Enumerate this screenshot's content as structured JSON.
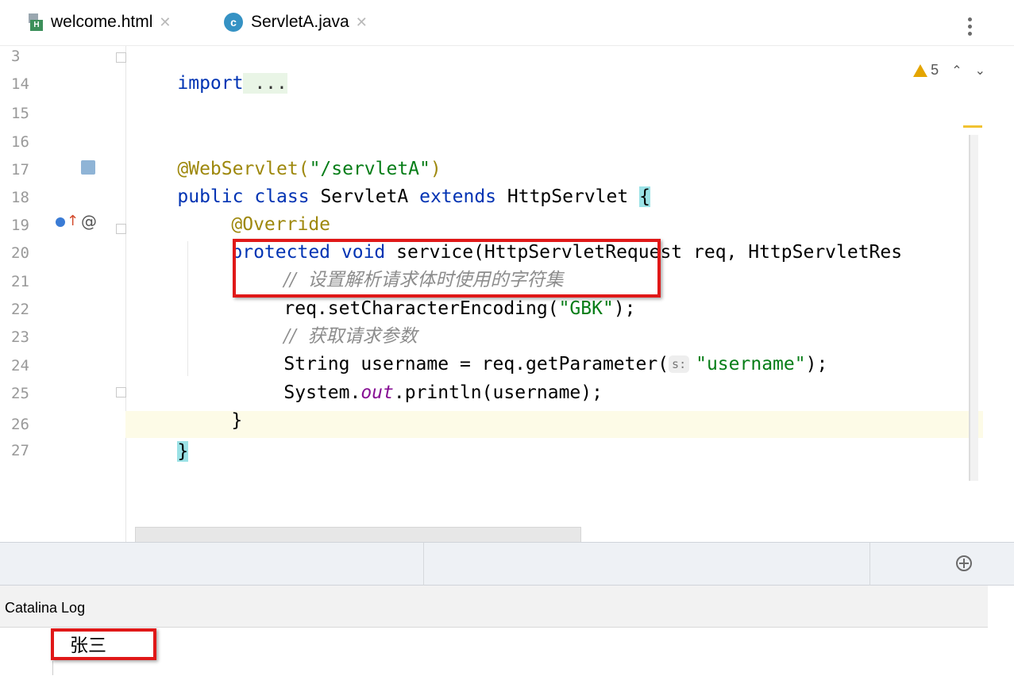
{
  "tabs": [
    {
      "label": "welcome.html",
      "icon": "html-file-icon",
      "active": false
    },
    {
      "label": "ServletA.java",
      "icon": "class-file-icon",
      "active": true
    }
  ],
  "inspection": {
    "warnings": "5"
  },
  "gutter": {
    "line_numbers": [
      "3",
      "14",
      "15",
      "16",
      "17",
      "18",
      "19",
      "20",
      "21",
      "22",
      "23",
      "24",
      "25",
      "26",
      "27"
    ],
    "override_marker": "@"
  },
  "code": {
    "l3_import": "import",
    "l3_folded": " ...",
    "l16_annotation": "@WebServlet(",
    "l16_string": "\"/servletA\"",
    "l16_close": ")",
    "l17_public": "public",
    "l17_class": "class",
    "l17_name": "ServletA",
    "l17_extends": "extends",
    "l17_super": "HttpServlet",
    "l17_brace": "{",
    "l18_override": "@Override",
    "l19_protected": "protected",
    "l19_void": "void",
    "l19_rest": "service(HttpServletRequest req, HttpServletRes",
    "l20_comment": "//  设置解析请求体时使用的字符集",
    "l21_call": "req.setCharacterEncoding(",
    "l21_string": "\"GBK\"",
    "l21_close": ");",
    "l22_comment": "//  获取请求参数",
    "l23_start": "String username = req.getParameter(",
    "l23_hint": "s:",
    "l23_string": "\"username\"",
    "l23_close": ");",
    "l24_system": "System.",
    "l24_out": "out",
    "l24_rest": ".println(username);",
    "l25_brace": "}",
    "l26_brace": "}"
  },
  "log": {
    "title": "Catalina Log",
    "output": "张三"
  },
  "colors": {
    "keyword": "#0033b3",
    "annotation": "#9e880d",
    "string": "#067d17",
    "comment": "#8c8c8c",
    "highlight_box": "#e01818",
    "warning": "#e4a500"
  }
}
